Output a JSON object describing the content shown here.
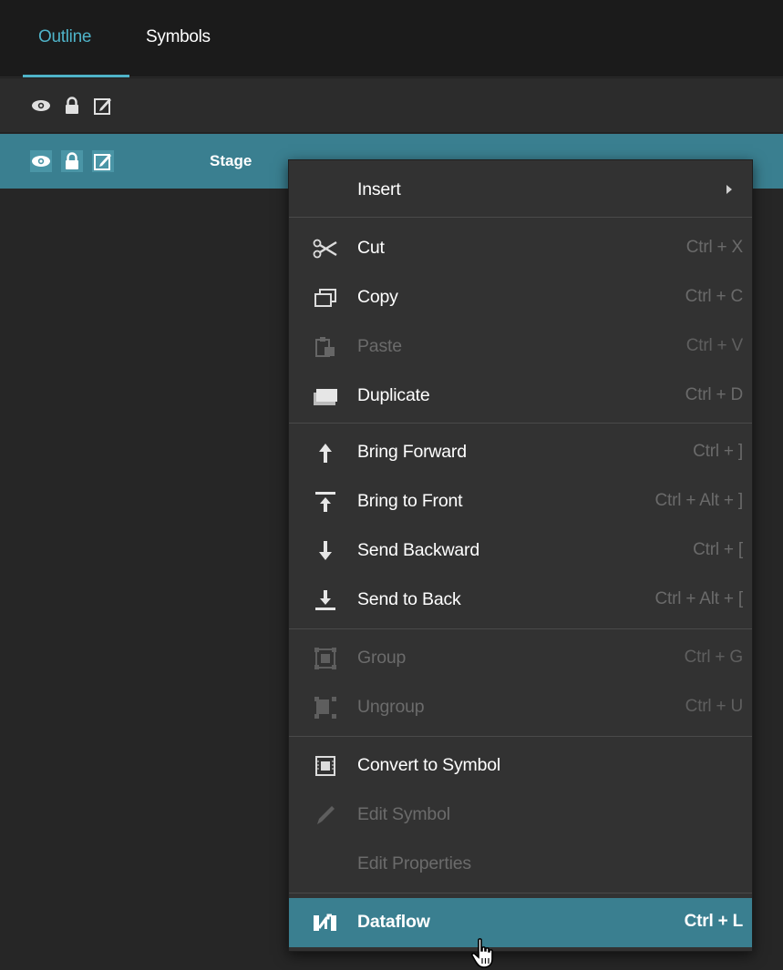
{
  "tabs": [
    {
      "label": "Outline",
      "active": true
    },
    {
      "label": "Symbols",
      "active": false
    }
  ],
  "outline": {
    "header_icons": [
      "eye-icon",
      "lock-icon",
      "edit-icon"
    ],
    "stage_row": {
      "label": "Stage",
      "selected": true
    }
  },
  "context_menu": {
    "insert": {
      "label": "Insert",
      "has_submenu": true
    },
    "cut": {
      "label": "Cut",
      "shortcut": "Ctrl + X",
      "icon": "scissors-icon",
      "enabled": true
    },
    "copy": {
      "label": "Copy",
      "shortcut": "Ctrl + C",
      "icon": "copy-icon",
      "enabled": true
    },
    "paste": {
      "label": "Paste",
      "shortcut": "Ctrl + V",
      "icon": "paste-icon",
      "enabled": false
    },
    "duplicate": {
      "label": "Duplicate",
      "shortcut": "Ctrl + D",
      "icon": "duplicate-icon",
      "enabled": true
    },
    "bring_forward": {
      "label": "Bring Forward",
      "shortcut": "Ctrl + ]",
      "icon": "arrow-up-icon",
      "enabled": true
    },
    "bring_to_front": {
      "label": "Bring to Front",
      "shortcut": "Ctrl + Alt + ]",
      "icon": "bring-to-front-icon",
      "enabled": true
    },
    "send_backward": {
      "label": "Send Backward",
      "shortcut": "Ctrl + [",
      "icon": "arrow-down-icon",
      "enabled": true
    },
    "send_to_back": {
      "label": "Send to Back",
      "shortcut": "Ctrl + Alt + [",
      "icon": "send-to-back-icon",
      "enabled": true
    },
    "group": {
      "label": "Group",
      "shortcut": "Ctrl + G",
      "icon": "group-icon",
      "enabled": false
    },
    "ungroup": {
      "label": "Ungroup",
      "shortcut": "Ctrl + U",
      "icon": "ungroup-icon",
      "enabled": false
    },
    "convert_to_symbol": {
      "label": "Convert to Symbol",
      "icon": "symbol-icon",
      "enabled": true
    },
    "edit_symbol": {
      "label": "Edit Symbol",
      "icon": "pencil-icon",
      "enabled": false
    },
    "edit_properties": {
      "label": "Edit Properties",
      "enabled": false
    },
    "dataflow": {
      "label": "Dataflow",
      "shortcut": "Ctrl + L",
      "icon": "dataflow-icon",
      "enabled": true,
      "hovered": true
    }
  },
  "colors": {
    "accent": "#4fb3c8",
    "selection": "#3a7f90",
    "menu_bg": "#323232",
    "panel_bg": "#262626"
  }
}
